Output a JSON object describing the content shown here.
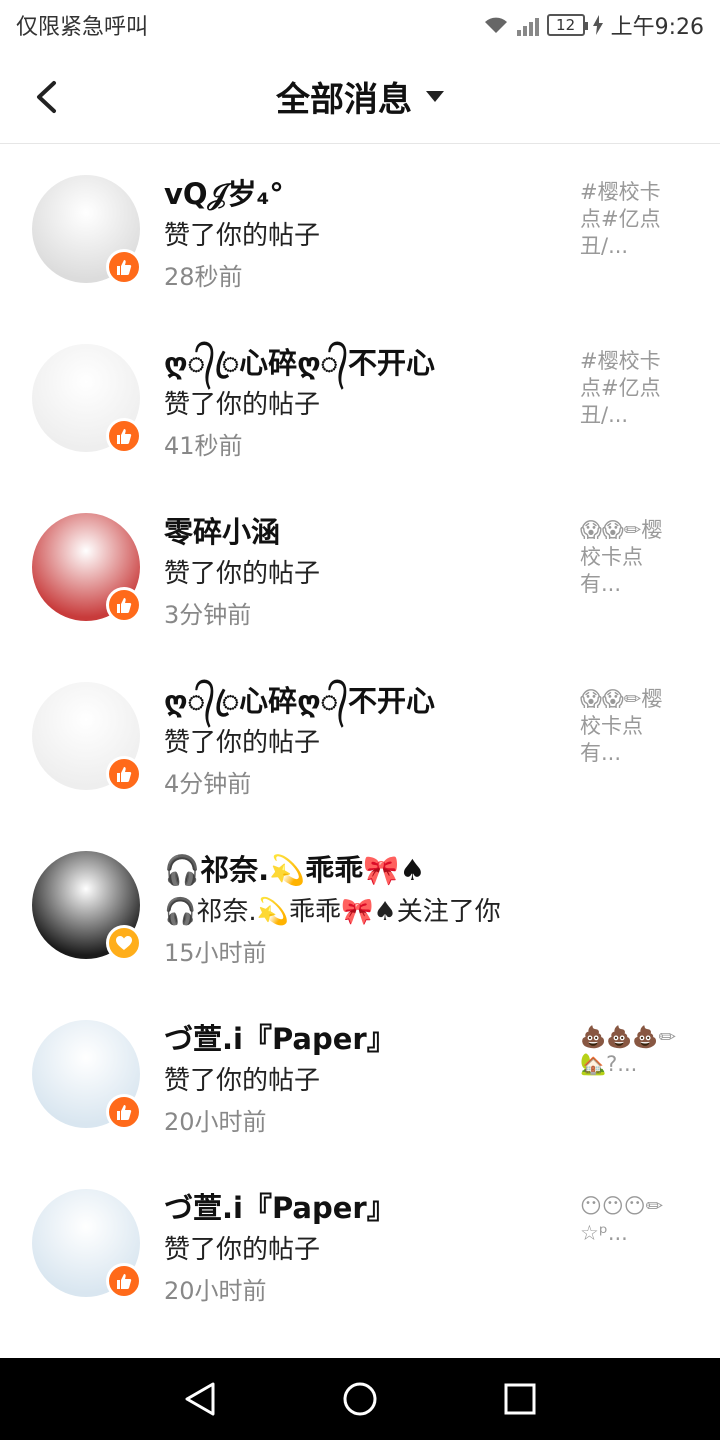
{
  "status_bar": {
    "left_text": "仅限紧急呼叫",
    "battery": "12",
    "time": "上午9:26"
  },
  "header": {
    "title": "全部消息",
    "back_icon": "back-arrow-icon",
    "dropdown_icon": "caret-down-icon"
  },
  "messages": [
    {
      "name": "vQ𝒥岁₄°",
      "action": "赞了你的帖子",
      "time": "28秒前",
      "preview": "#樱校卡点#亿点丑/...",
      "badge": "like",
      "avatar": "#dcdcdc"
    },
    {
      "name": "ღ᭄ꦿ心碎ღ᭄不开心",
      "action": "赞了你的帖子",
      "time": "41秒前",
      "preview": "#樱校卡点#亿点丑/...",
      "badge": "like",
      "avatar": "#eeeeee"
    },
    {
      "name": "零碎小涵",
      "action": "赞了你的帖子",
      "time": "3分钟前",
      "preview": "😱😱✏樱校卡点有...",
      "badge": "like",
      "avatar": "#c83b3b"
    },
    {
      "name": "ღ᭄ꦿ心碎ღ᭄不开心",
      "action": "赞了你的帖子",
      "time": "4分钟前",
      "preview": "😱😱✏樱校卡点有...",
      "badge": "like",
      "avatar": "#eeeeee"
    },
    {
      "name": "🎧祁奈.💫乖乖🎀♠",
      "action": "🎧祁奈.💫乖乖🎀♠关注了你",
      "time": "15小时前",
      "preview": "",
      "badge": "follow",
      "avatar": "#1a1a1a"
    },
    {
      "name": "づ萱.i『Paper』",
      "action": "赞了你的帖子",
      "time": "20小时前",
      "preview": "💩💩💩✏🏡?...",
      "badge": "like",
      "avatar": "#d9e6f0"
    },
    {
      "name": "づ萱.i『Paper』",
      "action": "赞了你的帖子",
      "time": "20小时前",
      "preview": "😶😶😶✏☆ᵖ...",
      "badge": "like",
      "avatar": "#d9e6f0"
    }
  ]
}
